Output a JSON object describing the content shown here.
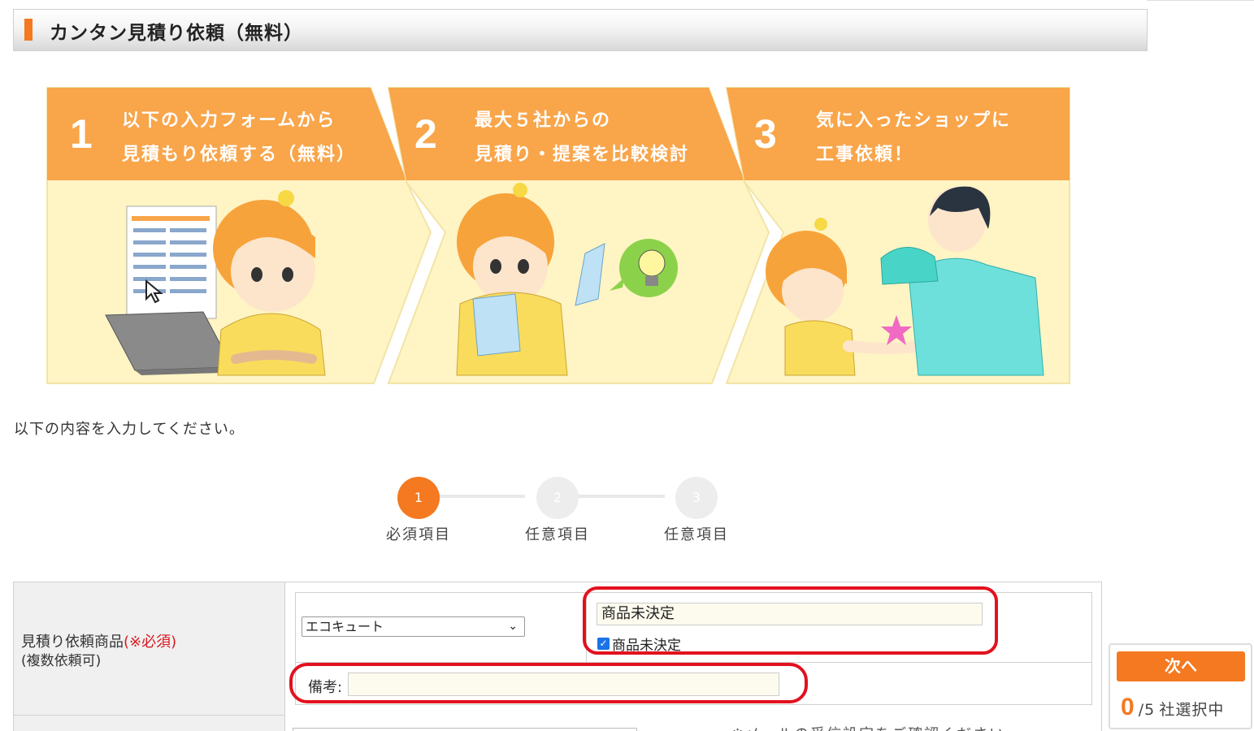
{
  "header": {
    "title": "カンタン見積り依頼（無料）"
  },
  "banner": {
    "steps": [
      {
        "num": "1",
        "line1": "以下の入力フォームから",
        "line2": "見積もり依頼する（無料）"
      },
      {
        "num": "2",
        "line1": "最大５社からの",
        "line2": "見積り・提案を比較検討"
      },
      {
        "num": "3",
        "line1": "気に入ったショップに",
        "line2": "工事依頼！"
      }
    ]
  },
  "intro_text": "以下の内容を入力してください。",
  "progress": {
    "current_step": 1,
    "steps": [
      {
        "num": "1",
        "label": "必須項目"
      },
      {
        "num": "2",
        "label": "任意項目"
      },
      {
        "num": "3",
        "label": "任意項目"
      }
    ]
  },
  "form": {
    "product_label": "見積り依頼商品",
    "required_mark": "(※必須)",
    "product_sublabel": "(複数依頼可)",
    "product_select_value": "エコキュート",
    "undecided_input_value": "商品未決定",
    "undecided_checkbox_label": "商品未決定",
    "undecided_checked": true,
    "note_label": "備考:",
    "note_value": "",
    "next_row_text": "※メールの受信設定をご確認ください"
  },
  "side_panel": {
    "next_label": "次へ",
    "selected_count": "0",
    "max_suffix": "/5",
    "selected_text": "社選択中"
  },
  "colors": {
    "accent": "#f47920",
    "highlight_ring": "#e2111e",
    "banner_bg": "#fff5c9",
    "banner_header": "#f9a54a"
  }
}
